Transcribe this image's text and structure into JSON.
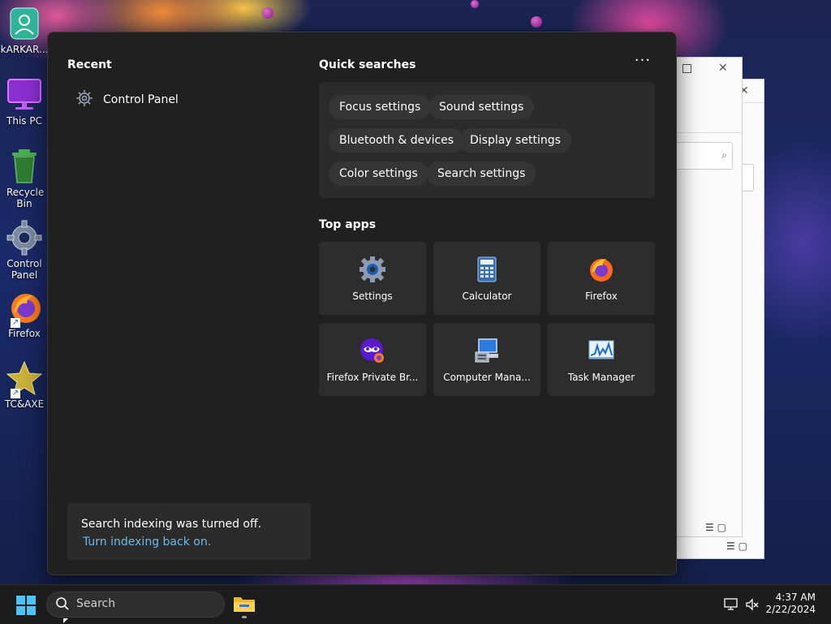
{
  "desktop": {
    "icons": [
      {
        "label": "kARKAR..."
      },
      {
        "label": "This PC"
      },
      {
        "label": "Recycle Bin"
      },
      {
        "label": "Control Panel"
      },
      {
        "label": "Firefox"
      },
      {
        "label": "TC&AXE"
      }
    ]
  },
  "panel": {
    "recent": {
      "title": "Recent",
      "items": [
        {
          "label": "Control Panel",
          "icon": "gear-icon"
        }
      ]
    },
    "quick_searches": {
      "title": "Quick searches",
      "more_label": "···",
      "chips": [
        {
          "label": "Focus settings"
        },
        {
          "label": "Sound settings"
        },
        {
          "label": "Bluetooth & devices"
        },
        {
          "label": "Display settings"
        },
        {
          "label": "Color settings"
        },
        {
          "label": "Search settings"
        }
      ]
    },
    "top_apps": {
      "title": "Top apps",
      "apps": [
        {
          "label": "Settings",
          "icon": "settings-gear-icon"
        },
        {
          "label": "Calculator",
          "icon": "calculator-icon"
        },
        {
          "label": "Firefox",
          "icon": "firefox-icon"
        },
        {
          "label": "Firefox Private Br...",
          "icon": "firefox-private-icon"
        },
        {
          "label": "Computer Mana...",
          "icon": "computer-management-icon"
        },
        {
          "label": "Task Manager",
          "icon": "task-manager-icon"
        }
      ]
    },
    "notice": {
      "message": "Search indexing was turned off.",
      "link": "Turn indexing back on."
    }
  },
  "taskbar": {
    "search_placeholder": "Search",
    "time": "4:37 AM",
    "date": "2/22/2024"
  },
  "colors": {
    "panel_bg": "#202020",
    "chip_bg": "#353535",
    "link": "#6cb8e8",
    "taskbar_bg": "#1c1c1c"
  }
}
